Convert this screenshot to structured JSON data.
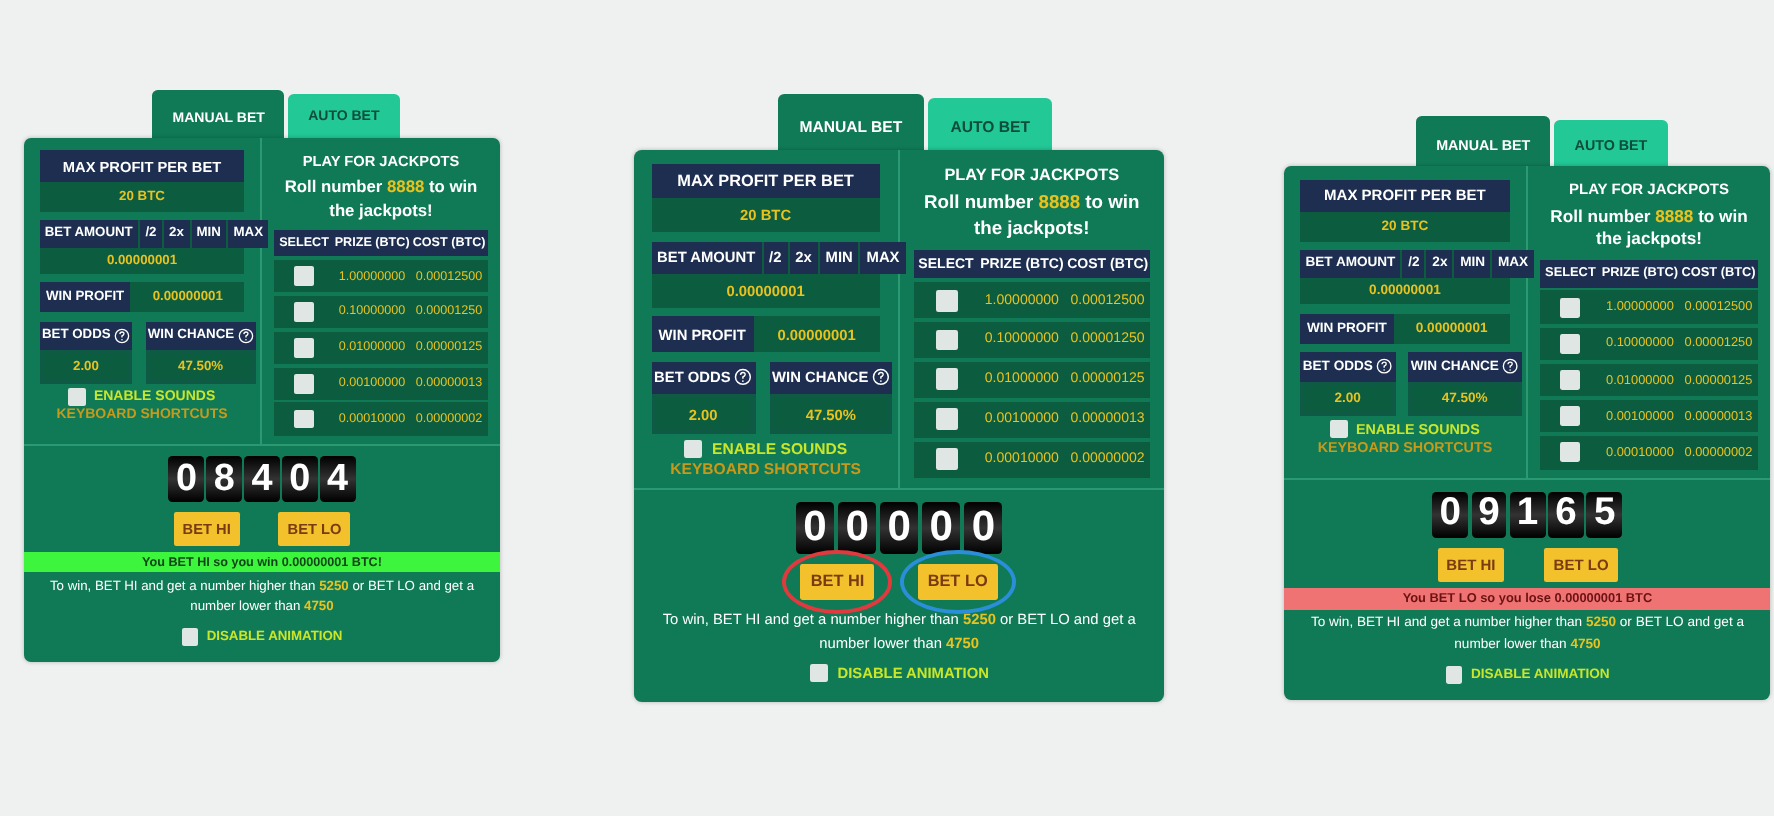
{
  "panels": [
    {
      "tabs": [
        {
          "label": "MANUAL BET",
          "selected": true
        },
        {
          "label": "AUTO BET",
          "selected": false
        }
      ],
      "max_profit": {
        "label": "MAX PROFIT PER BET",
        "value": "20 BTC"
      },
      "bet_amount": {
        "label": "BET AMOUNT",
        "actions": [
          "/2",
          "2x",
          "MIN",
          "MAX"
        ],
        "value": "0.00000001"
      },
      "win_profit": {
        "label": "WIN PROFIT",
        "value": "0.00000001"
      },
      "bet_odds": {
        "label": "BET ODDS",
        "value": "2.00"
      },
      "win_chance": {
        "label": "WIN CHANCE",
        "value": "47.50%"
      },
      "enable_sounds": {
        "label": "ENABLE SOUNDS",
        "checked": false
      },
      "keyboard_shortcuts": "KEYBOARD SHORTCUTS",
      "jackpots": {
        "title": "PLAY FOR JACKPOTS",
        "subtitle": "Roll number **8888** to win the jackpots!",
        "columns": [
          "SELECT",
          "PRIZE (BTC)",
          "COST (BTC)"
        ],
        "rows": [
          {
            "checked": false,
            "prize": "1.00000000",
            "cost": "0.00012500"
          },
          {
            "checked": false,
            "prize": "0.10000000",
            "cost": "0.00001250"
          },
          {
            "checked": false,
            "prize": "0.01000000",
            "cost": "0.00000125"
          },
          {
            "checked": false,
            "prize": "0.00100000",
            "cost": "0.00000013"
          },
          {
            "checked": false,
            "prize": "0.00010000",
            "cost": "0.00000002"
          }
        ]
      },
      "roll_digits": [
        "0",
        "8",
        "4",
        "0",
        "4"
      ],
      "buttons": [
        {
          "label": "BET HI"
        },
        {
          "label": "BET LO"
        }
      ],
      "result": {
        "kind": "win",
        "text": "You BET HI so you win 0.00000001 BTC!"
      },
      "rule": "To win, BET HI and get a number higher than **5250** or BET LO and get a number lower than **4750**",
      "disable_animation": {
        "label": "DISABLE ANIMATION",
        "checked": false
      }
    },
    {
      "tabs": [
        {
          "label": "MANUAL BET",
          "selected": true
        },
        {
          "label": "AUTO BET",
          "selected": false
        }
      ],
      "max_profit": {
        "label": "MAX PROFIT PER BET",
        "value": "20 BTC"
      },
      "bet_amount": {
        "label": "BET AMOUNT",
        "actions": [
          "/2",
          "2x",
          "MIN",
          "MAX"
        ],
        "value": "0.00000001"
      },
      "win_profit": {
        "label": "WIN PROFIT",
        "value": "0.00000001"
      },
      "bet_odds": {
        "label": "BET ODDS",
        "value": "2.00"
      },
      "win_chance": {
        "label": "WIN CHANCE",
        "value": "47.50%"
      },
      "enable_sounds": {
        "label": "ENABLE SOUNDS",
        "checked": false
      },
      "keyboard_shortcuts": "KEYBOARD SHORTCUTS",
      "jackpots": {
        "title": "PLAY FOR JACKPOTS",
        "subtitle": "Roll number **8888** to win the jackpots!",
        "columns": [
          "SELECT",
          "PRIZE (BTC)",
          "COST (BTC)"
        ],
        "rows": [
          {
            "checked": false,
            "prize": "1.00000000",
            "cost": "0.00012500"
          },
          {
            "checked": false,
            "prize": "0.10000000",
            "cost": "0.00001250"
          },
          {
            "checked": false,
            "prize": "0.01000000",
            "cost": "0.00000125"
          },
          {
            "checked": false,
            "prize": "0.00100000",
            "cost": "0.00000013"
          },
          {
            "checked": false,
            "prize": "0.00010000",
            "cost": "0.00000002"
          }
        ]
      },
      "roll_digits": [
        "0",
        "0",
        "0",
        "0",
        "0"
      ],
      "buttons": [
        {
          "label": "BET HI",
          "color": "#e0393e"
        },
        {
          "label": "BET LO",
          "color": "#2a8fd8"
        }
      ],
      "rule": "To win, BET HI and get a number higher than **5250** or BET LO and get a number lower than **4750**",
      "disable_animation": {
        "label": "DISABLE ANIMATION",
        "checked": false
      }
    },
    {
      "tabs": [
        {
          "label": "MANUAL BET",
          "selected": true
        },
        {
          "label": "AUTO BET",
          "selected": false
        }
      ],
      "max_profit": {
        "label": "MAX PROFIT PER BET",
        "value": "20 BTC"
      },
      "bet_amount": {
        "label": "BET AMOUNT",
        "actions": [
          "/2",
          "2x",
          "MIN",
          "MAX"
        ],
        "value": "0.00000001"
      },
      "win_profit": {
        "label": "WIN PROFIT",
        "value": "0.00000001"
      },
      "bet_odds": {
        "label": "BET ODDS",
        "value": "2.00"
      },
      "win_chance": {
        "label": "WIN CHANCE",
        "value": "47.50%"
      },
      "enable_sounds": {
        "label": "ENABLE SOUNDS",
        "checked": false
      },
      "keyboard_shortcuts": "KEYBOARD SHORTCUTS",
      "jackpots": {
        "title": "PLAY FOR JACKPOTS",
        "subtitle": "Roll number **8888** to win the jackpots!",
        "columns": [
          "SELECT",
          "PRIZE (BTC)",
          "COST (BTC)"
        ],
        "rows": [
          {
            "checked": false,
            "prize": "1.00000000",
            "cost": "0.00012500"
          },
          {
            "checked": false,
            "prize": "0.10000000",
            "cost": "0.00001250"
          },
          {
            "checked": false,
            "prize": "0.01000000",
            "cost": "0.00000125"
          },
          {
            "checked": false,
            "prize": "0.00100000",
            "cost": "0.00000013"
          },
          {
            "checked": false,
            "prize": "0.00010000",
            "cost": "0.00000002"
          }
        ]
      },
      "roll_digits": [
        "0",
        "9",
        "1",
        "6",
        "5"
      ],
      "buttons": [
        {
          "label": "BET HI"
        },
        {
          "label": "BET LO"
        }
      ],
      "result": {
        "kind": "lose",
        "text": "You BET LO so you lose 0.00000001 BTC"
      },
      "rule": "To win, BET HI and get a number higher than **5250** or BET LO and get a number lower than **4750**",
      "disable_animation": {
        "label": "DISABLE ANIMATION",
        "checked": false
      }
    }
  ]
}
